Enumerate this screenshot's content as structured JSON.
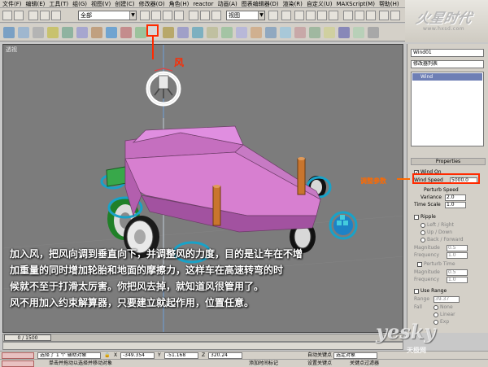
{
  "menu": [
    "文件(F)",
    "编辑(E)",
    "工具(T)",
    "组(G)",
    "视图(V)",
    "创建(C)",
    "修改器(O)",
    "角色(H)",
    "reactor",
    "动画(A)",
    "图表编辑器(D)",
    "渲染(R)",
    "自定义(U)",
    "MAXScript(M)",
    "帮助(H)"
  ],
  "toolbar": {
    "selection_filter": "全部",
    "ref_coord": "视图"
  },
  "brand": {
    "logo": "火星时代",
    "url": "www.hxsd.com"
  },
  "viewport": {
    "label": "透视"
  },
  "command_panel": {
    "object_name": "Wind01",
    "modifier_list": "修改器列表",
    "stack_item": "Wind",
    "rollout_title": "Properties",
    "wind_on_label": "Wind On",
    "wind_speed_label": "Wind Speed",
    "wind_speed_value": "5000.0",
    "perturb_speed_label": "Perturb Speed",
    "variance_label": "Variance",
    "variance_value": "2.0",
    "time_scale_label": "Time Scale",
    "time_scale_value": "1.0",
    "ripple_label": "Ripple",
    "left_right_label": "Left / Right",
    "up_down_label": "Up / Down",
    "back_forward_label": "Back / Forward",
    "magnitude_label": "Magnitude",
    "magnitude_value": "0.5",
    "frequency_label": "Frequency",
    "frequency_value": "1.0",
    "perturb_time_label": "Perturb Time",
    "magnitude2_value": "0.5",
    "frequency2_value": "1.0",
    "use_range_label": "Use Range",
    "range_label": "Range",
    "range_value": "39.37",
    "fall_label": "Fall",
    "none_label": "None",
    "linear_label": "Linear",
    "exp_label": "Exp"
  },
  "timeline": {
    "slider_label": "0 / 1500"
  },
  "status": {
    "selection_text": "选择了 1 个 辅助对象",
    "prompt_text": "单击并拖动以选择并移动对象",
    "x_value": "-349.354",
    "y_value": "-51.168",
    "z_value": "320.24",
    "add_time_tag": "添加时间标记",
    "auto_key": "自动关键点",
    "set_key": "设置关键点",
    "selected_object": "选定对象",
    "key_filter": "关键点过滤器"
  },
  "annotations": {
    "wind_label": "风",
    "param_label": "调整参数",
    "caption_lines": [
      "加入风，把风向调到垂直向下，并调整风的力度，目的是让车在不增",
      "加重量的同时增加轮胎和地面的摩擦力，这样车在高速转弯的时",
      "候就不至于打滑太厉害。你把风去掉，就知道风很管用了。",
      "风不用加入约束解算器，只要建立就起作用，位置任意。"
    ],
    "watermark": "yesky",
    "watermark_sub": "天极网"
  },
  "colors": {
    "car_body": "#d77fd0",
    "wheel_green": "#2e8b3a",
    "helper_blue": "#19a2c8",
    "wood_post": "#c9752d",
    "annotation_red": "#ff2a00",
    "viewport_bg": "#7c7c7c"
  }
}
